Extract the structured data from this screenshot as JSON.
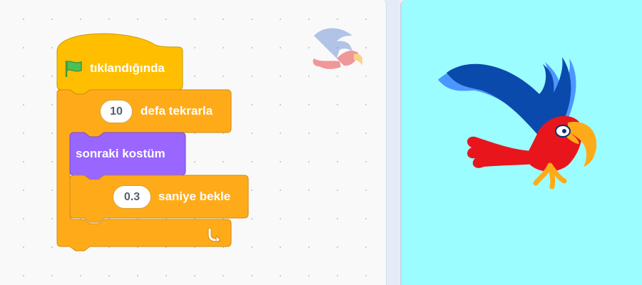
{
  "scripts": {
    "hat": {
      "label": "tıklandığında",
      "icon": "green-flag-icon",
      "color": "#ffbf00"
    },
    "repeat": {
      "count": "10",
      "label": "defa tekrarla",
      "loop_icon": "loop-arrow-icon",
      "color": "#ffab19"
    },
    "next_costume": {
      "label": "sonraki kostüm",
      "color": "#9966ff"
    },
    "wait": {
      "seconds": "0.3",
      "label": "saniye bekle",
      "color": "#ffab19"
    }
  },
  "sprite": {
    "name_icon": "parrot-sprite",
    "thumbnail_icon": "parrot-thumbnail"
  },
  "stage": {
    "background": "#9bfdff"
  }
}
